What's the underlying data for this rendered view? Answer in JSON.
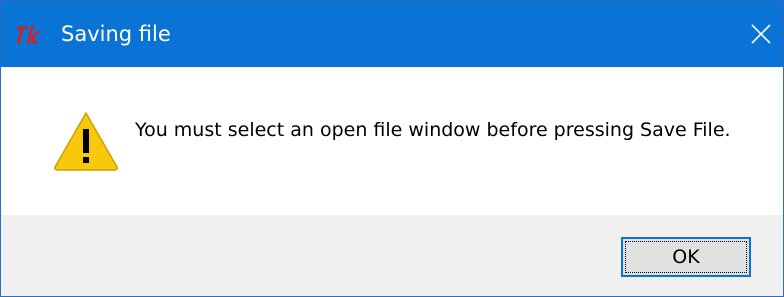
{
  "window": {
    "title": "Saving file",
    "app_icon": "tk-feather-icon",
    "close_icon": "close-icon",
    "accent_color": "#0a74d6"
  },
  "dialog": {
    "icon": "warning-icon",
    "message": "You must select an open file window before pressing Save File."
  },
  "buttons": {
    "ok_label": "OK"
  }
}
